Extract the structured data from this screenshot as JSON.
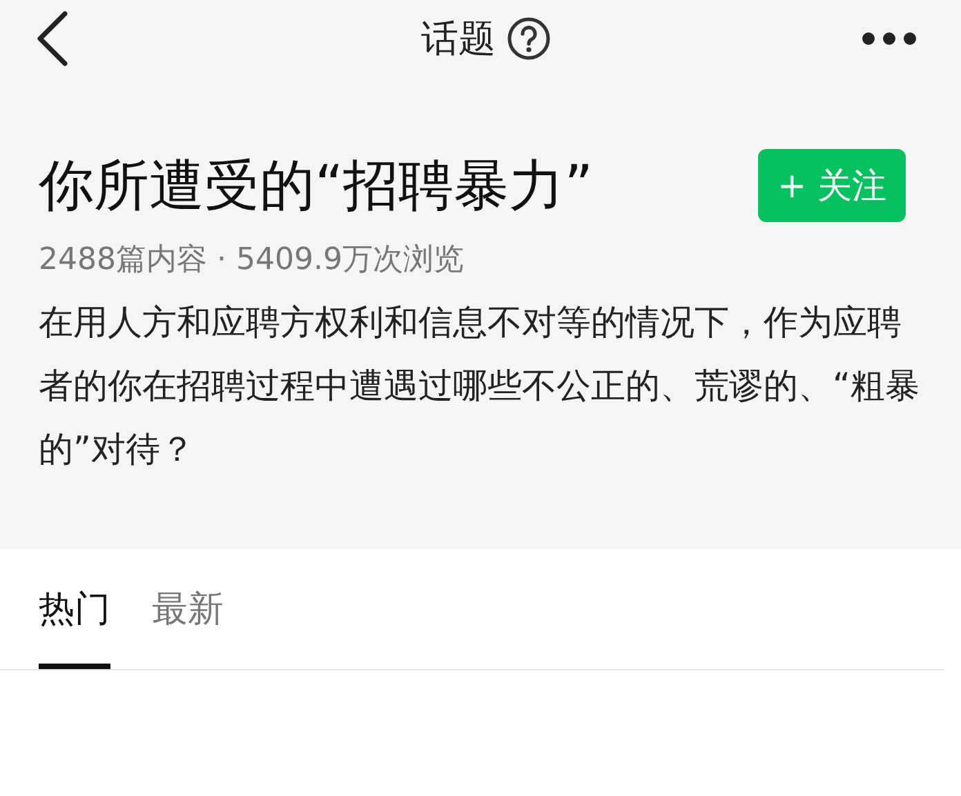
{
  "nav": {
    "title": "话题"
  },
  "topic": {
    "title": "你所遭受的“招聘暴力”",
    "follow_button": "+ 关注",
    "stats": "2488篇内容 · 5409.9万次浏览",
    "description": "在用人方和应聘方权利和信息不对等的情况下，作为应聘者的你在招聘过程中遭遇过哪些不公正的、荒谬的、“粗暴的”对待？"
  },
  "tabs": [
    {
      "label": "热门",
      "selected": true
    },
    {
      "label": "最新",
      "selected": false
    }
  ]
}
